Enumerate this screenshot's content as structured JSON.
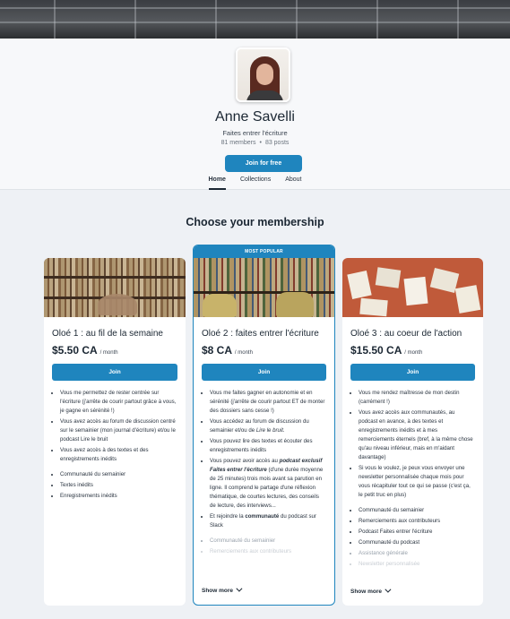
{
  "profile": {
    "name": "Anne Savelli",
    "tagline": "Faites entrer l'écriture",
    "members": "81 members",
    "posts": "83 posts",
    "join_label": "Join for free",
    "socials": [
      "x-icon",
      "youtube-icon",
      "instagram-icon"
    ]
  },
  "tabs": [
    {
      "label": "Home",
      "active": true
    },
    {
      "label": "Collections",
      "active": false
    },
    {
      "label": "About",
      "active": false
    }
  ],
  "section_title": "Choose your membership",
  "tiers": [
    {
      "title": "Oloé 1 : au fil de la semaine",
      "price": "$5.50 CA",
      "period": "/ month",
      "button": "Join",
      "bullets": [
        "Vous me permettez de rester centrée sur l'écriture (j'arrête de courir partout grâce à vous, je gagne en sérénité !)",
        "Vous avez accès au forum de discussion centré sur le semainier (mon journal d'écriture) et/ou le podcast Lire le bruit",
        "Vous avez accès à des textes et des enregistrements inédits"
      ],
      "benefits": [
        "Communauté du semainier",
        "Textes inédits",
        "Enregistrements inédits"
      ]
    },
    {
      "badge": "MOST POPULAR",
      "title": "Oloé 2 : faites entrer l'écriture",
      "price": "$8 CA",
      "period": "/ month",
      "button": "Join",
      "bullets": [
        "Vous me faites gagner en autonomie et en sérénité (j'arrête de courir partout ET de monter des dossiers sans cesse !)",
        "Vous accédez au forum de discussion du semainier et/ou de",
        "Vous pouvez lire des textes et écouter des enregistrements inédits",
        "Vous pouvez avoir accès au",
        "Et rejoindre la"
      ],
      "bullet2_em": "Lire le bruit.",
      "bullet4_bold": "podcast exclusif Faites entrer l'écriture",
      "bullet4_rest": "(d'une durée moyenne de 25 minutes) trois mois avant sa parution en ligne. Il comprend le partage d'une réflexion thématique, de courtes lectures, des conseils de lecture, des interviews...",
      "bullet5_bold": "communauté",
      "bullet5_rest": "du podcast sur Slack",
      "benefits": [
        "Communauté du semainier",
        "Remerciements aux contributeurs"
      ],
      "show_more": "Show more"
    },
    {
      "title": "Oloé 3 : au coeur de l'action",
      "price": "$15.50 CA",
      "period": "/ month",
      "button": "Join",
      "bullets": [
        "Vous me rendez maîtresse de mon destin (carrément !)",
        "Vous avez accès aux communautés, au podcast en avance, à des textes et enregistrements inédits et à mes remerciements éternels (bref, à la même chose qu'au niveau inférieur, mais en m'aidant davantage)",
        "Si vous le voulez, je peux vous envoyer une newsletter personnalisée chaque mois pour vous récapituler tout ce qui se passe (c'est ça, le petit truc en plus)"
      ],
      "benefits": [
        "Communauté du semainier",
        "Remerciements aux contributeurs",
        "Podcast Faites entrer l'écriture",
        "Communauté du podcast",
        "Assistance générale",
        "Newsletter personnalisée"
      ],
      "show_more": "Show more"
    }
  ],
  "colors": {
    "accent": "#1f85be",
    "background": "#eef1f5",
    "text": "#1b2733"
  }
}
